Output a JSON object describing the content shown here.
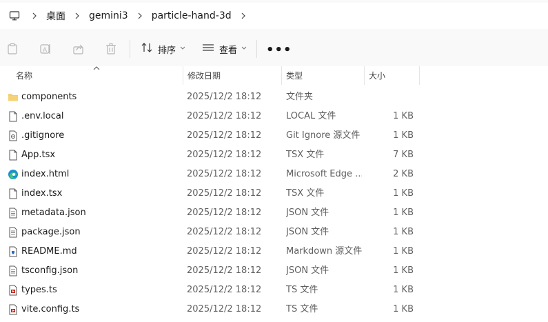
{
  "breadcrumb": {
    "items": [
      "桌面",
      "gemini3",
      "particle-hand-3d"
    ]
  },
  "toolbar": {
    "sort_label": "排序",
    "view_label": "查看",
    "more_label": "•••"
  },
  "columns": {
    "name": "名称",
    "modified": "修改日期",
    "type": "类型",
    "size": "大小"
  },
  "files": [
    {
      "name": "components",
      "modified": "2025/12/2 18:12",
      "type": "文件夹",
      "size": "",
      "icon": "folder-icon"
    },
    {
      "name": ".env.local",
      "modified": "2025/12/2 18:12",
      "type": "LOCAL 文件",
      "size": "1 KB",
      "icon": "file-icon"
    },
    {
      "name": ".gitignore",
      "modified": "2025/12/2 18:12",
      "type": "Git Ignore 源文件",
      "size": "1 KB",
      "icon": "gear-file-icon"
    },
    {
      "name": "App.tsx",
      "modified": "2025/12/2 18:12",
      "type": "TSX 文件",
      "size": "7 KB",
      "icon": "file-icon"
    },
    {
      "name": "index.html",
      "modified": "2025/12/2 18:12",
      "type": "Microsoft Edge ...",
      "size": "2 KB",
      "icon": "edge-icon"
    },
    {
      "name": "index.tsx",
      "modified": "2025/12/2 18:12",
      "type": "TSX 文件",
      "size": "1 KB",
      "icon": "file-icon"
    },
    {
      "name": "metadata.json",
      "modified": "2025/12/2 18:12",
      "type": "JSON 文件",
      "size": "1 KB",
      "icon": "text-file-icon"
    },
    {
      "name": "package.json",
      "modified": "2025/12/2 18:12",
      "type": "JSON 文件",
      "size": "1 KB",
      "icon": "text-file-icon"
    },
    {
      "name": "README.md",
      "modified": "2025/12/2 18:12",
      "type": "Markdown 源文件",
      "size": "1 KB",
      "icon": "markdown-file-icon"
    },
    {
      "name": "tsconfig.json",
      "modified": "2025/12/2 18:12",
      "type": "JSON 文件",
      "size": "1 KB",
      "icon": "text-file-icon"
    },
    {
      "name": "types.ts",
      "modified": "2025/12/2 18:12",
      "type": "TS 文件",
      "size": "1 KB",
      "icon": "media-file-icon"
    },
    {
      "name": "vite.config.ts",
      "modified": "2025/12/2 18:12",
      "type": "TS 文件",
      "size": "1 KB",
      "icon": "media-file-icon"
    }
  ],
  "colors": {
    "folder": "#f2c55c",
    "edge": "#1a8fd4",
    "media_accent": "#c42b1c"
  }
}
